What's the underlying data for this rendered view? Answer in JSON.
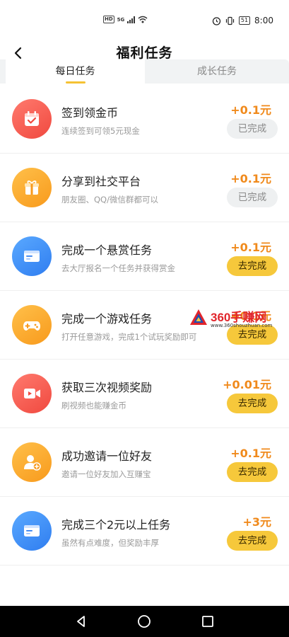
{
  "status_bar": {
    "network_badge": "HD",
    "network_type": "5G",
    "battery": "51",
    "time": "8:00",
    "icons": [
      "hd-icon",
      "signal-icon",
      "wifi-icon",
      "alarm-icon",
      "vibrate-icon",
      "battery-icon"
    ]
  },
  "header": {
    "back_icon": "back-arrow-icon",
    "title": "福利任务"
  },
  "tabs": [
    {
      "label": "每日任务",
      "active": true
    },
    {
      "label": "成长任务",
      "active": false
    }
  ],
  "tasks": [
    {
      "icon": "calendar-check-icon",
      "color": "red",
      "title": "签到领金币",
      "desc": "连续签到可领5元现金",
      "reward": "+0.1元",
      "button": "已完成",
      "completed": true
    },
    {
      "icon": "gift-box-icon",
      "color": "orange",
      "title": "分享到社交平台",
      "desc": "朋友圈、QQ/微信群都可以",
      "reward": "+0.1元",
      "button": "已完成",
      "completed": true
    },
    {
      "icon": "browser-window-icon",
      "color": "blue",
      "title": "完成一个悬赏任务",
      "desc": "去大厅报名一个任务并获得赏金",
      "reward": "+0.1元",
      "button": "去完成",
      "completed": false
    },
    {
      "icon": "gamepad-icon",
      "color": "orange",
      "title": "完成一个游戏任务",
      "desc": "打开任意游戏，完成1个试玩奖励即可",
      "reward": "+0.1元",
      "button": "去完成",
      "completed": false
    },
    {
      "icon": "video-camera-icon",
      "color": "red",
      "title": "获取三次视频奖励",
      "desc": "刷视频也能赚金币",
      "reward": "+0.01元",
      "button": "去完成",
      "completed": false
    },
    {
      "icon": "add-user-icon",
      "color": "orange",
      "title": "成功邀请一位好友",
      "desc": "邀请一位好友加入互赚宝",
      "reward": "+0.1元",
      "button": "去完成",
      "completed": false
    },
    {
      "icon": "browser-window-icon",
      "color": "blue",
      "title": "完成三个2元以上任务",
      "desc": "虽然有点难度，但奖励丰厚",
      "reward": "+3元",
      "button": "去完成",
      "completed": false
    }
  ],
  "watermark": {
    "brand": "360手赚网",
    "url": "www.360shouzhuan.com"
  },
  "system_nav": {
    "icons": [
      "back-triangle-icon",
      "home-circle-icon",
      "recents-square-icon"
    ]
  },
  "colors": {
    "reward": "#f08a1c",
    "button_go": "#f6c83b",
    "button_done": "#eef0f1",
    "tab_indicator": "#f5c233"
  }
}
